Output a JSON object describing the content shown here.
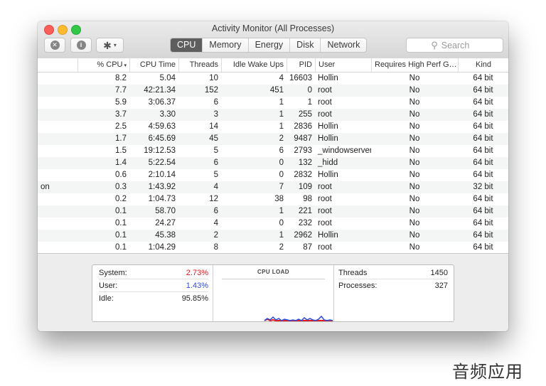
{
  "window": {
    "title": "Activity Monitor (All Processes)"
  },
  "toolbar": {
    "tabs": [
      {
        "label": "CPU",
        "active": true
      },
      {
        "label": "Memory",
        "active": false
      },
      {
        "label": "Energy",
        "active": false
      },
      {
        "label": "Disk",
        "active": false
      },
      {
        "label": "Network",
        "active": false
      }
    ],
    "search_placeholder": "Search",
    "icons": {
      "stop": "stop-icon",
      "info": "info-icon",
      "gear": "gear-icon",
      "search": "search-icon"
    }
  },
  "table": {
    "columns": {
      "cpu": "% CPU",
      "cpu_time": "CPU Time",
      "threads": "Threads",
      "idle_wake_ups": "Idle Wake Ups",
      "pid": "PID",
      "user": "User",
      "high_perf": "Requires High Perf G…",
      "kind": "Kind"
    },
    "sort_indicator": "chevron-down-icon",
    "rows": [
      {
        "name": "",
        "cpu": "8.2",
        "cpu_time": "5.04",
        "threads": "10",
        "idle": "4",
        "pid": "16603",
        "user": "Hollin",
        "high_perf": "No",
        "kind": "64 bit"
      },
      {
        "name": "",
        "cpu": "7.7",
        "cpu_time": "42:21.34",
        "threads": "152",
        "idle": "451",
        "pid": "0",
        "user": "root",
        "high_perf": "No",
        "kind": "64 bit"
      },
      {
        "name": "",
        "cpu": "5.9",
        "cpu_time": "3:06.37",
        "threads": "6",
        "idle": "1",
        "pid": "1",
        "user": "root",
        "high_perf": "No",
        "kind": "64 bit"
      },
      {
        "name": "",
        "cpu": "3.7",
        "cpu_time": "3.30",
        "threads": "3",
        "idle": "1",
        "pid": "255",
        "user": "root",
        "high_perf": "No",
        "kind": "64 bit"
      },
      {
        "name": "",
        "cpu": "2.5",
        "cpu_time": "4:59.63",
        "threads": "14",
        "idle": "1",
        "pid": "2836",
        "user": "Hollin",
        "high_perf": "No",
        "kind": "64 bit"
      },
      {
        "name": "",
        "cpu": "1.7",
        "cpu_time": "6:45.69",
        "threads": "45",
        "idle": "2",
        "pid": "9487",
        "user": "Hollin",
        "high_perf": "No",
        "kind": "64 bit"
      },
      {
        "name": "",
        "cpu": "1.5",
        "cpu_time": "19:12.53",
        "threads": "5",
        "idle": "6",
        "pid": "2793",
        "user": "_windowserver",
        "high_perf": "No",
        "kind": "64 bit"
      },
      {
        "name": "",
        "cpu": "1.4",
        "cpu_time": "5:22.54",
        "threads": "6",
        "idle": "0",
        "pid": "132",
        "user": "_hidd",
        "high_perf": "No",
        "kind": "64 bit"
      },
      {
        "name": "",
        "cpu": "0.6",
        "cpu_time": "2:10.14",
        "threads": "5",
        "idle": "0",
        "pid": "2832",
        "user": "Hollin",
        "high_perf": "No",
        "kind": "64 bit"
      },
      {
        "name": "on",
        "cpu": "0.3",
        "cpu_time": "1:43.92",
        "threads": "4",
        "idle": "7",
        "pid": "109",
        "user": "root",
        "high_perf": "No",
        "kind": "32 bit"
      },
      {
        "name": "",
        "cpu": "0.2",
        "cpu_time": "1:04.73",
        "threads": "12",
        "idle": "38",
        "pid": "98",
        "user": "root",
        "high_perf": "No",
        "kind": "64 bit"
      },
      {
        "name": "",
        "cpu": "0.1",
        "cpu_time": "58.70",
        "threads": "6",
        "idle": "1",
        "pid": "221",
        "user": "root",
        "high_perf": "No",
        "kind": "64 bit"
      },
      {
        "name": "",
        "cpu": "0.1",
        "cpu_time": "24.27",
        "threads": "4",
        "idle": "0",
        "pid": "232",
        "user": "root",
        "high_perf": "No",
        "kind": "64 bit"
      },
      {
        "name": "",
        "cpu": "0.1",
        "cpu_time": "45.38",
        "threads": "2",
        "idle": "1",
        "pid": "2962",
        "user": "Hollin",
        "high_perf": "No",
        "kind": "64 bit"
      },
      {
        "name": "",
        "cpu": "0.1",
        "cpu_time": "1:04.29",
        "threads": "8",
        "idle": "2",
        "pid": "87",
        "user": "root",
        "high_perf": "No",
        "kind": "64 bit"
      }
    ]
  },
  "summary": {
    "system": {
      "label": "System:",
      "value": "2.73%",
      "color": "#e8151b"
    },
    "user": {
      "label": "User:",
      "value": "1.43%",
      "color": "#2d4ce0"
    },
    "idle": {
      "label": "Idle:",
      "value": "95.85%"
    },
    "graph_title": "CPU LOAD",
    "threads": {
      "label": "Threads",
      "value": "1450"
    },
    "processes": {
      "label": "Processes:",
      "value": "327"
    }
  },
  "watermark": "音频应用"
}
